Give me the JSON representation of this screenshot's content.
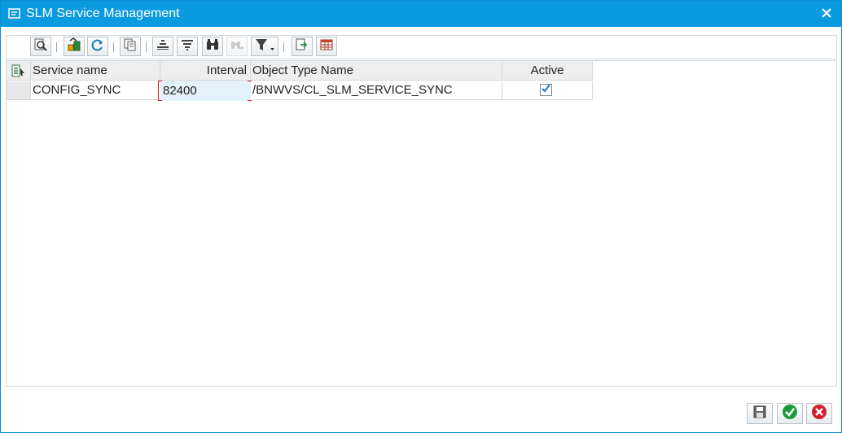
{
  "window": {
    "title": "SLM Service Management",
    "window_icon": "window-menu-icon",
    "close_icon": "close-icon"
  },
  "toolbar": {
    "buttons": [
      {
        "name": "details-button",
        "icon": "magnifier-details-icon",
        "enabled": true
      },
      {
        "name": "check-button",
        "icon": "check-objects-icon",
        "enabled": true
      },
      {
        "name": "refresh-button",
        "icon": "refresh-icon",
        "enabled": true
      },
      {
        "name": "copy-button",
        "icon": "copy-icon",
        "enabled": true
      },
      {
        "name": "sort-ascending-button",
        "icon": "sort-ascending-icon",
        "enabled": true
      },
      {
        "name": "sort-descending-button",
        "icon": "sort-descending-icon",
        "enabled": true
      },
      {
        "name": "find-button",
        "icon": "binoculars-icon",
        "enabled": true
      },
      {
        "name": "find-next-button",
        "icon": "binoculars-plus-icon",
        "enabled": false
      },
      {
        "name": "filter-button",
        "icon": "filter-icon",
        "enabled": true
      },
      {
        "name": "export-button",
        "icon": "export-icon",
        "enabled": true
      },
      {
        "name": "layout-button",
        "icon": "table-layout-icon",
        "enabled": true
      }
    ]
  },
  "table": {
    "select_all_icon": "select-layout-icon",
    "columns": {
      "service_name": "Service name",
      "interval": "Interval",
      "object_type_name": "Object Type Name",
      "active": "Active"
    },
    "rows": [
      {
        "service_name": "CONFIG_SYNC",
        "interval": "82400",
        "object_type_name": "/BNWVS/CL_SLM_SERVICE_SYNC",
        "active": true
      }
    ]
  },
  "footer": {
    "save_icon": "save-icon",
    "confirm_icon": "confirm-check-icon",
    "cancel_icon": "cancel-icon"
  },
  "colors": {
    "title_bar": "#0a9ae0",
    "edit_cell": "#e3f1fb",
    "confirm_green": "#1e9a3a",
    "cancel_red": "#d0202a"
  }
}
